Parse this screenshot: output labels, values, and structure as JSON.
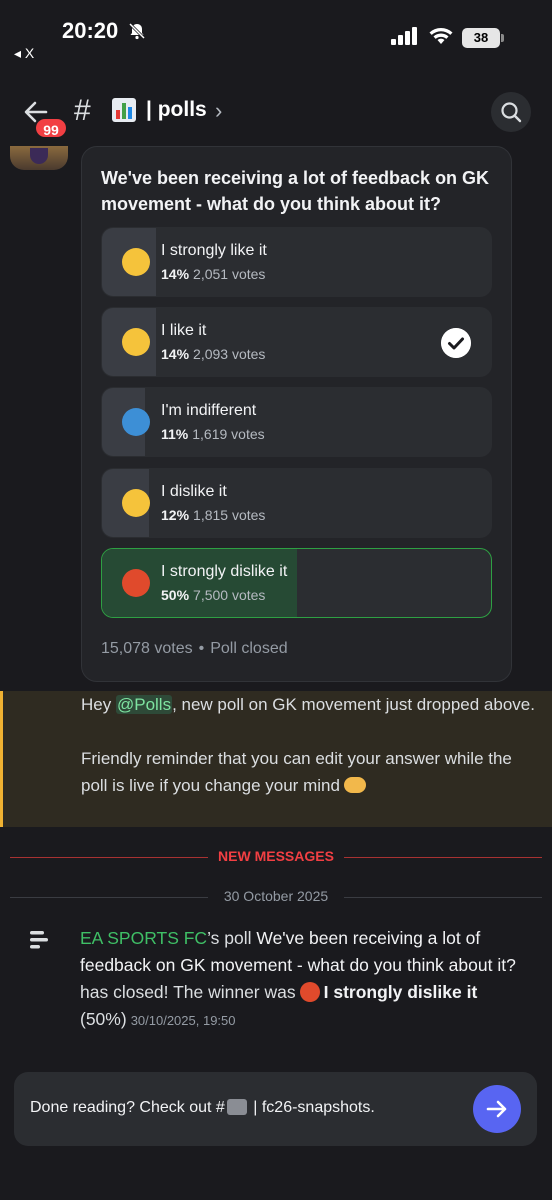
{
  "status_bar": {
    "time": "20:20",
    "back_app": "◂ X",
    "battery": "38"
  },
  "header": {
    "unread_count": "99",
    "hash": "#",
    "title": "| polls",
    "chevron": "›"
  },
  "poll": {
    "question": "We've been receiving a lot of feedback on GK movement - what do you think about it?",
    "options": [
      {
        "emoji": "grinning-face",
        "emoji_color": "#f5c33b",
        "label": "I strongly like it",
        "percent": "14%",
        "votes": "2,051 votes",
        "fill": 0.14,
        "selected": false,
        "winner": false
      },
      {
        "emoji": "slightly-smiling-face",
        "emoji_color": "#f5c33b",
        "label": "I like it",
        "percent": "14%",
        "votes": "2,093 votes",
        "fill": 0.14,
        "selected": true,
        "winner": false
      },
      {
        "emoji": "person-shrugging",
        "emoji_color": "#3d8fd6",
        "label": "I'm indifferent",
        "percent": "11%",
        "votes": "1,619 votes",
        "fill": 0.11,
        "selected": false,
        "winner": false
      },
      {
        "emoji": "slightly-frowning-face",
        "emoji_color": "#f5c33b",
        "label": "I dislike it",
        "percent": "12%",
        "votes": "1,815 votes",
        "fill": 0.12,
        "selected": false,
        "winner": false
      },
      {
        "emoji": "angry-face",
        "emoji_color": "#e04a2c",
        "label": "I strongly dislike it",
        "percent": "50%",
        "votes": "7,500 votes",
        "fill": 0.5,
        "selected": false,
        "winner": true
      }
    ],
    "total_votes": "15,078 votes",
    "separator": "•",
    "status": "Poll closed"
  },
  "mention_message": {
    "prefix": "Hey ",
    "mention": "@Polls",
    "line1_rest": ", new poll on GK movement just dropped above.",
    "line2": "Friendly reminder that you can edit your answer while the poll is live if you change your mind"
  },
  "dividers": {
    "new_messages": "NEW MESSAGES",
    "date": "30 October 2025"
  },
  "system_message": {
    "author": "EA SPORTS FC",
    "author_suffix": "’s poll ",
    "question": "We've been receiving a lot of feedback on GK movement - what do you think about it?",
    "closed_text": " has closed! The winner was",
    "winner": "I strongly dislike it",
    "winner_pct": " (50%)",
    "timestamp": "30/10/2025, 19:50"
  },
  "bottom_bar": {
    "text_before": "Done reading? Check out #",
    "text_after": " | fc26-snapshots."
  },
  "colors": {
    "accent": "#5865f2",
    "winner_border": "#2ea043",
    "mention_bar": "#f0b232",
    "new_messages": "#f23f43"
  }
}
